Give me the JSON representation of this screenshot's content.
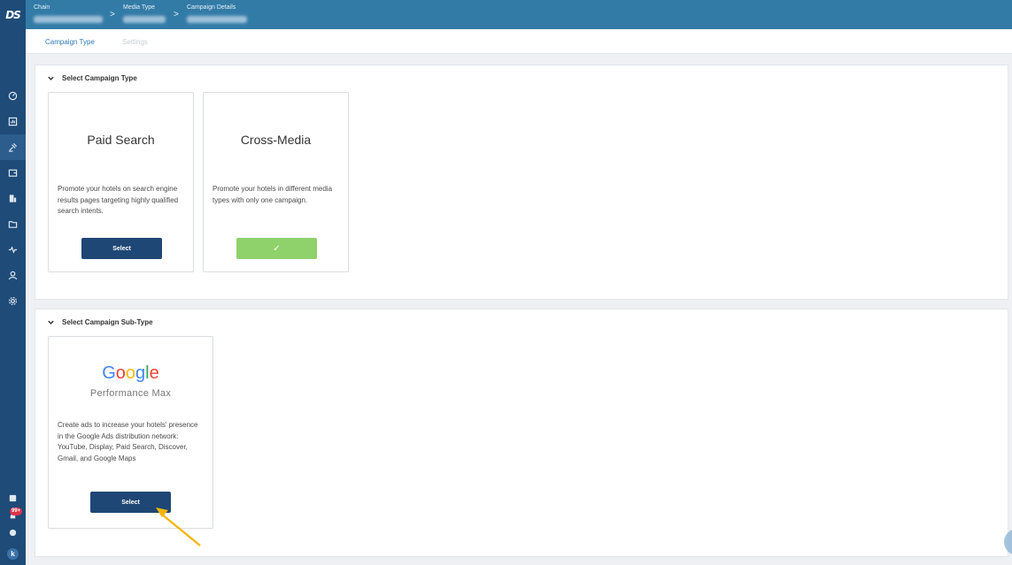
{
  "logo": "DS",
  "breadcrumb": {
    "items": [
      {
        "label": "Chain"
      },
      {
        "label": "Media Type"
      },
      {
        "label": "Campaign Details"
      }
    ],
    "separator": ">"
  },
  "tabs": [
    {
      "label": "Campaign Type",
      "active": true
    },
    {
      "label": "Settings",
      "active": false
    }
  ],
  "sidebar": {
    "items": [
      "home-icon",
      "chart-icon",
      "campaign-icon",
      "wallet-icon",
      "building-icon",
      "folder-icon",
      "activity-icon",
      "user-icon",
      "gear-icon"
    ],
    "active_index": 2,
    "bottom": {
      "notification_badge": "99+",
      "avatar_initial": "k"
    }
  },
  "campaign_type": {
    "header": "Select Campaign Type",
    "cards": [
      {
        "title": "Paid Search",
        "description": "Promote your hotels on search engine results pages targeting highly qualified search intents.",
        "button": "Select",
        "selected": false
      },
      {
        "title": "Cross-Media",
        "description": "Promote your hotels in different media types with only one campaign.",
        "button": "✓",
        "selected": true
      }
    ]
  },
  "campaign_subtype": {
    "header": "Select Campaign Sub-Type",
    "cards": [
      {
        "brand": "Google",
        "subtitle": "Performance Max",
        "description": "Create ads to increase your hotels' presence in the Google Ads distribution network: YouTube, Display, Paid Search, Discover, Gmail, and Google Maps",
        "button": "Select"
      }
    ]
  },
  "colors": {
    "sidebar": "#1e4b78",
    "topbar": "#337ba7",
    "primary_button": "#1f4775",
    "selected_button": "#8fd16b",
    "active_tab": "#2f7ab8",
    "annotation_arrow": "#f5b400"
  }
}
